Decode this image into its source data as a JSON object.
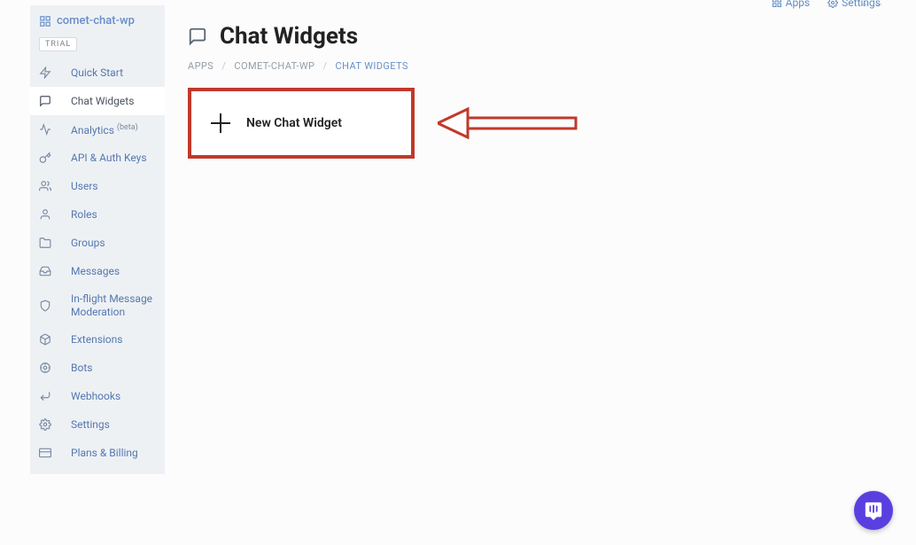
{
  "topbar": {
    "apps": "Apps",
    "settings": "Settings"
  },
  "sidebar": {
    "app_name": "comet-chat-wp",
    "trial_label": "TRIAL",
    "items": [
      {
        "label": "Quick Start"
      },
      {
        "label": "Chat Widgets"
      },
      {
        "label": "Analytics",
        "badge": "(beta)"
      },
      {
        "label": "API & Auth Keys"
      },
      {
        "label": "Users"
      },
      {
        "label": "Roles"
      },
      {
        "label": "Groups"
      },
      {
        "label": "Messages"
      },
      {
        "label": "In-flight Message Moderation"
      },
      {
        "label": "Extensions"
      },
      {
        "label": "Bots"
      },
      {
        "label": "Webhooks"
      },
      {
        "label": "Settings"
      },
      {
        "label": "Plans & Billing"
      }
    ]
  },
  "page": {
    "title": "Chat Widgets",
    "new_widget_label": "New Chat Widget"
  },
  "breadcrumbs": {
    "crumb0": "APPS",
    "crumb1": "COMET-CHAT-WP",
    "crumb2": "CHAT WIDGETS"
  }
}
